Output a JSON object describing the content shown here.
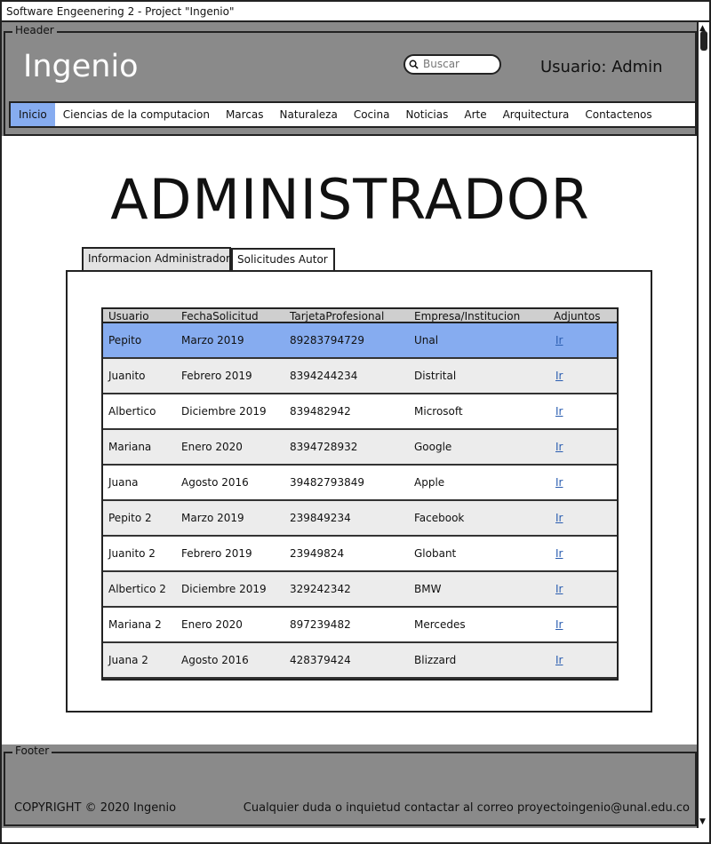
{
  "window": {
    "title": "Software Engeenering 2 - Project  \"Ingenio\""
  },
  "header": {
    "group_label": "Header",
    "logo": "Ingenio",
    "search_placeholder": "Buscar",
    "user": "Usuario: Admin"
  },
  "nav": {
    "items": [
      {
        "label": "Inicio",
        "active": true
      },
      {
        "label": "Ciencias de la computacion"
      },
      {
        "label": "Marcas"
      },
      {
        "label": "Naturaleza"
      },
      {
        "label": "Cocina"
      },
      {
        "label": "Noticias"
      },
      {
        "label": "Arte"
      },
      {
        "label": "Arquitectura"
      },
      {
        "label": "Contactenos"
      }
    ]
  },
  "page": {
    "title": "ADMINISTRADOR"
  },
  "tabs": [
    {
      "label": "Informacion Administrador",
      "active": false
    },
    {
      "label": "Solicitudes Autor",
      "active": true
    }
  ],
  "table": {
    "columns": [
      "Usuario",
      "FechaSolicitud",
      "TarjetaProfesional",
      "Empresa/Institucion",
      "Adjuntos"
    ],
    "rows": [
      [
        "Pepito",
        "Marzo 2019",
        "89283794729",
        "Unal",
        "Ir"
      ],
      [
        "Juanito",
        "Febrero 2019",
        "8394244234",
        "Distrital",
        "Ir"
      ],
      [
        "Albertico",
        "Diciembre 2019",
        "839482942",
        "Microsoft",
        "Ir"
      ],
      [
        "Mariana",
        "Enero 2020",
        "8394728932",
        "Google",
        "Ir"
      ],
      [
        "Juana",
        "Agosto 2016",
        "39482793849",
        "Apple",
        "Ir"
      ],
      [
        "Pepito 2",
        "Marzo 2019",
        "239849234",
        "Facebook",
        "Ir"
      ],
      [
        "Juanito 2",
        "Febrero 2019",
        "23949824",
        "Globant",
        "Ir"
      ],
      [
        "Albertico 2",
        "Diciembre 2019",
        "329242342",
        "BMW",
        "Ir"
      ],
      [
        "Mariana 2",
        "Enero 2020",
        "897239482",
        "Mercedes",
        "Ir"
      ],
      [
        "Juana 2",
        "Agosto 2016",
        "428379424",
        "Blizzard",
        "Ir"
      ]
    ],
    "selected_row": 0
  },
  "footer": {
    "group_label": "Footer",
    "copyright": "COPYRIGHT © 2020 Ingenio",
    "contact": "Cualquier duda o inquietud contactar al correo proyectoingenio@unal.edu.co"
  },
  "colors": {
    "accent": "#86acf0",
    "header_bg": "#8a8a8a",
    "link": "#2a5db0"
  }
}
